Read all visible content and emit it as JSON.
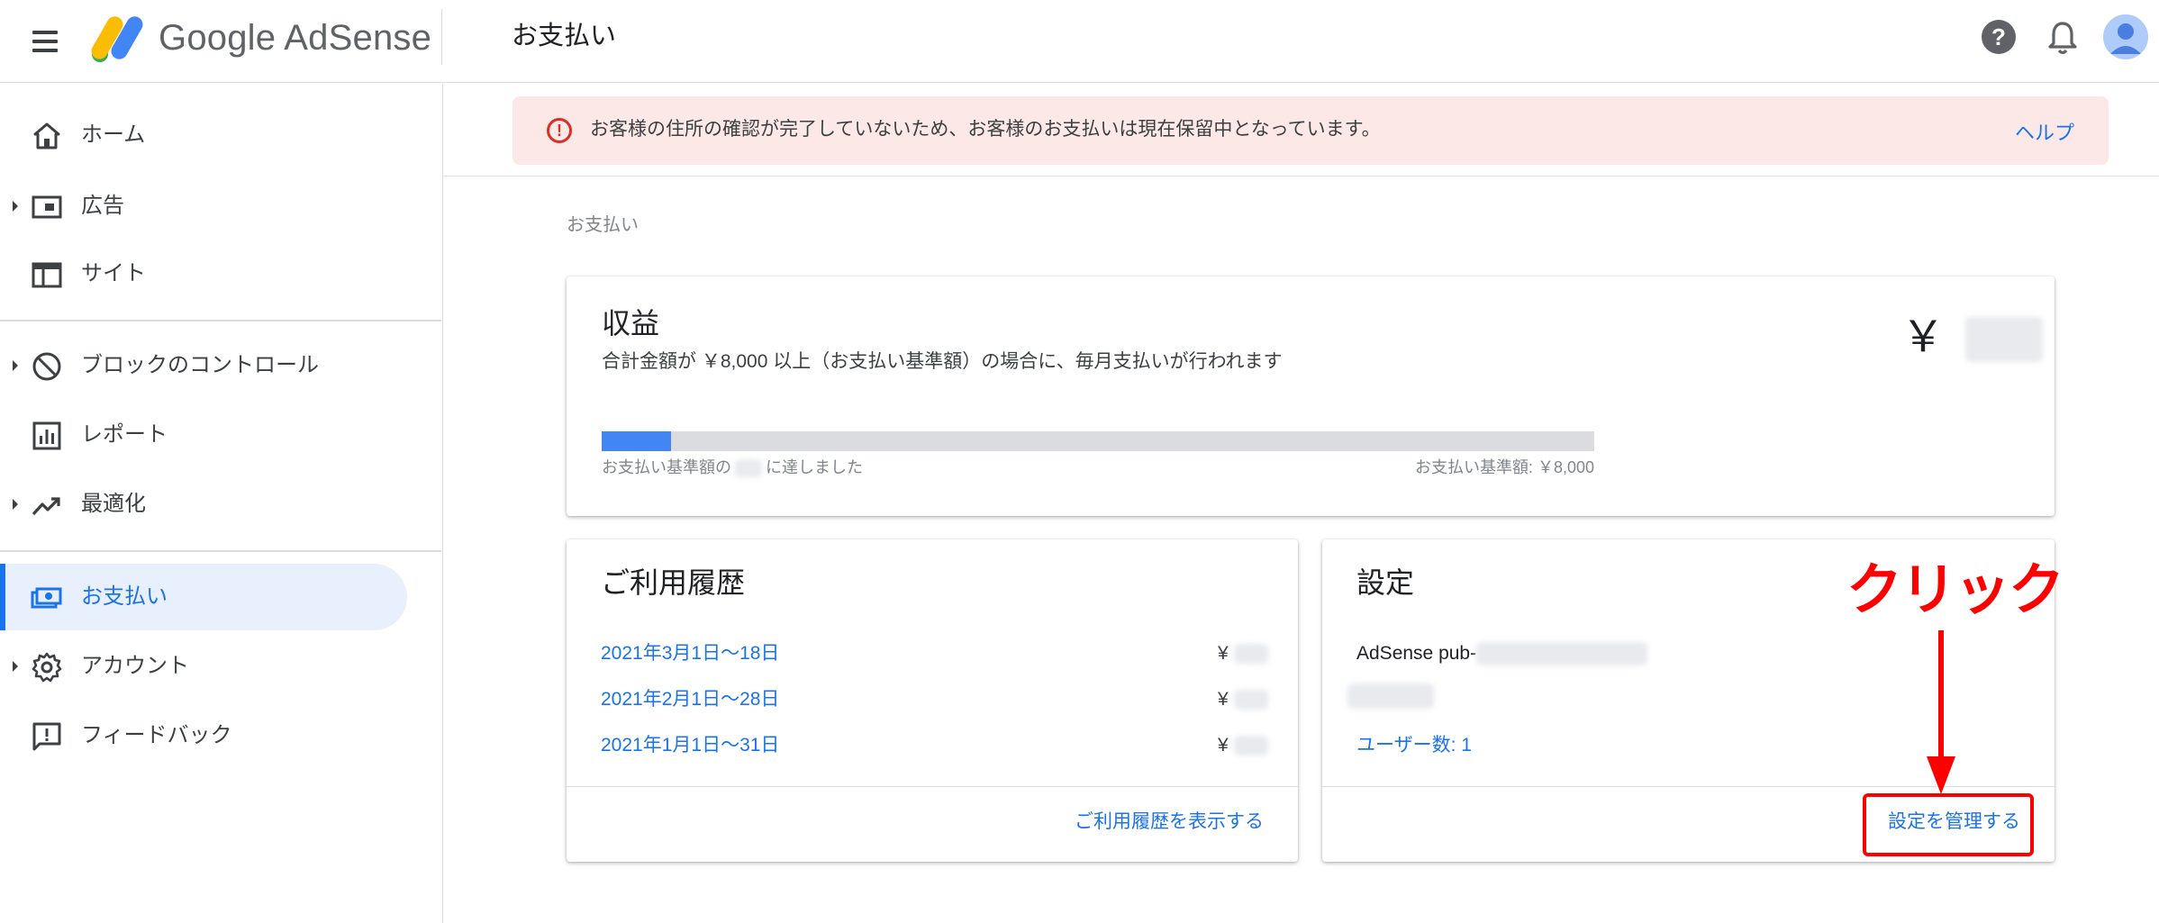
{
  "header": {
    "brand": "Google AdSense",
    "page_title": "お支払い"
  },
  "sidebar": {
    "items": [
      {
        "label": "ホーム",
        "icon": "home-icon"
      },
      {
        "label": "広告",
        "icon": "ads-icon"
      },
      {
        "label": "サイト",
        "icon": "sites-icon"
      },
      {
        "label": "ブロックのコントロール",
        "icon": "block-icon"
      },
      {
        "label": "レポート",
        "icon": "reports-icon"
      },
      {
        "label": "最適化",
        "icon": "optimization-icon"
      },
      {
        "label": "お支払い",
        "icon": "payments-icon"
      },
      {
        "label": "アカウント",
        "icon": "gear-icon"
      },
      {
        "label": "フィードバック",
        "icon": "feedback-icon"
      }
    ]
  },
  "alert": {
    "message": "お客様の住所の確認が完了していないため、お客様のお支払いは現在保留中となっています。",
    "help_link": "ヘルプ"
  },
  "breadcrumb": "お支払い",
  "earnings": {
    "title": "収益",
    "description": "合計金額が ￥8,000 以上（お支払い基準額）の場合に、毎月支払いが行われます",
    "currency": "￥",
    "progress_fraction": 0.07,
    "progress_left_prefix": "お支払い基準額の",
    "progress_left_suffix": "に達しました",
    "progress_right": "お支払い基準額: ￥8,000"
  },
  "history": {
    "title": "ご利用履歴",
    "rows": [
      {
        "period": "2021年3月1日～18日",
        "currency": "¥"
      },
      {
        "period": "2021年2月1日～28日",
        "currency": "¥"
      },
      {
        "period": "2021年1月1日～31日",
        "currency": "¥"
      }
    ],
    "view_link": "ご利用履歴を表示する"
  },
  "settings": {
    "title": "設定",
    "publisher_prefix": "AdSense pub-",
    "users_link": "ユーザー数: 1",
    "manage_link": "設定を管理する"
  },
  "annotation": {
    "text": "クリック"
  },
  "colors": {
    "accent": "#1a73e8",
    "active_bg": "#e8f0fe",
    "alert_bg": "#fce8e6",
    "alert_icon": "#d93025",
    "progress_fill": "#4285f4",
    "annotation": "#ff0000"
  }
}
